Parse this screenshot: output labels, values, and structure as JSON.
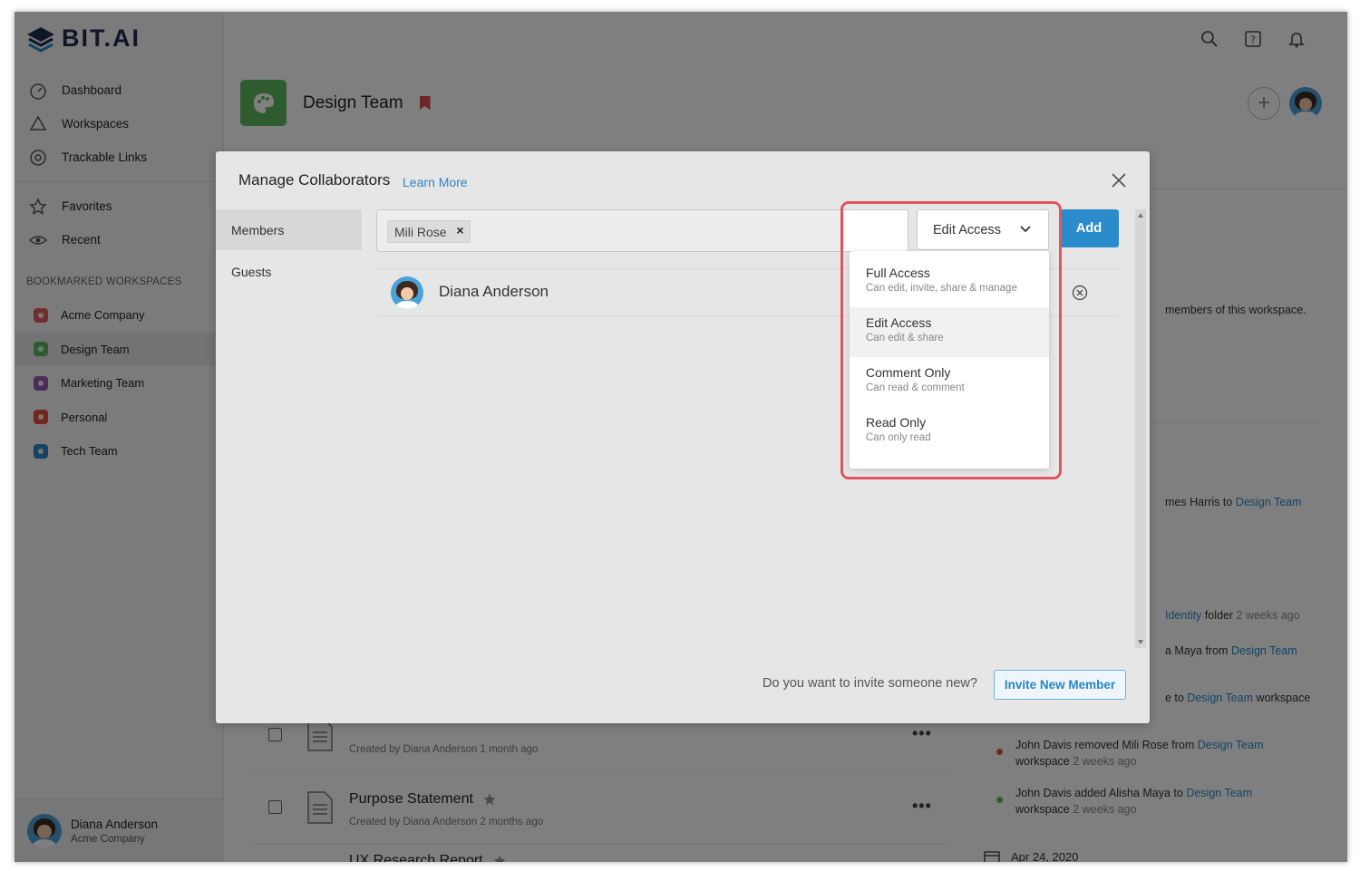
{
  "app": {
    "logo_text": "BIT.AI"
  },
  "sidebar": {
    "nav": [
      {
        "label": "Dashboard",
        "icon": "dashboard-icon"
      },
      {
        "label": "Workspaces",
        "icon": "workspaces-icon"
      },
      {
        "label": "Trackable Links",
        "icon": "trackable-links-icon"
      }
    ],
    "nav2": [
      {
        "label": "Favorites",
        "icon": "star-icon"
      },
      {
        "label": "Recent",
        "icon": "eye-icon"
      }
    ],
    "bookmarked_title": "BOOKMARKED WORKSPACES",
    "workspaces": [
      {
        "label": "Acme Company",
        "color": "#e35d5d"
      },
      {
        "label": "Design Team",
        "color": "#5cb85c"
      },
      {
        "label": "Marketing Team",
        "color": "#9b59b6"
      },
      {
        "label": "Personal",
        "color": "#e74c3c"
      },
      {
        "label": "Tech Team",
        "color": "#2a86c6"
      }
    ],
    "user": {
      "name": "Diana Anderson",
      "company": "Acme Company"
    }
  },
  "workspace": {
    "title": "Design Team"
  },
  "background": {
    "feed": {
      "members_text": "members of this workspace.",
      "item1_pre": "mes Harris to ",
      "item1_link": "Design Team",
      "item2_link": "Identity",
      "item2_mid": " folder ",
      "item2_time": "2 weeks ago",
      "item3_pre": "a Maya from ",
      "item3_link": "Design Team",
      "item4_pre": "e to ",
      "item4_link": "Design Team",
      "item4_post": " workspace",
      "item5_pre": "John Davis removed Mili Rose from ",
      "item5_link": "Design Team",
      "item5_post": "workspace ",
      "item5_time": "2 weeks ago",
      "item6_pre": "John Davis added Alisha Maya to ",
      "item6_link": "Design Team",
      "item6_post": "workspace ",
      "item6_time": "2 weeks ago",
      "date": "Apr 24, 2020"
    },
    "docs": [
      {
        "title": "",
        "sub": "Created by Diana Anderson 1 month ago"
      },
      {
        "title": "Purpose Statement",
        "sub": "Created by Diana Anderson 2 months ago"
      },
      {
        "title": "UX Research Report",
        "sub": ""
      }
    ]
  },
  "modal": {
    "title": "Manage Collaborators",
    "learn_more": "Learn More",
    "tabs": [
      "Members",
      "Guests"
    ],
    "chip": "Mili Rose",
    "access_selected": "Edit Access",
    "add_label": "Add",
    "member_name": "Diana Anderson",
    "invite_question": "Do you want to invite someone new?",
    "invite_button": "Invite New Member",
    "access_options": [
      {
        "title": "Full Access",
        "sub": "Can edit, invite, share & manage"
      },
      {
        "title": "Edit Access",
        "sub": "Can edit & share"
      },
      {
        "title": "Comment Only",
        "sub": "Can read & comment"
      },
      {
        "title": "Read Only",
        "sub": "Can only read"
      }
    ]
  },
  "colors": {
    "accent": "#2b8ccc",
    "highlight": "#e0565f",
    "workspace_green": "#5cb85c"
  }
}
